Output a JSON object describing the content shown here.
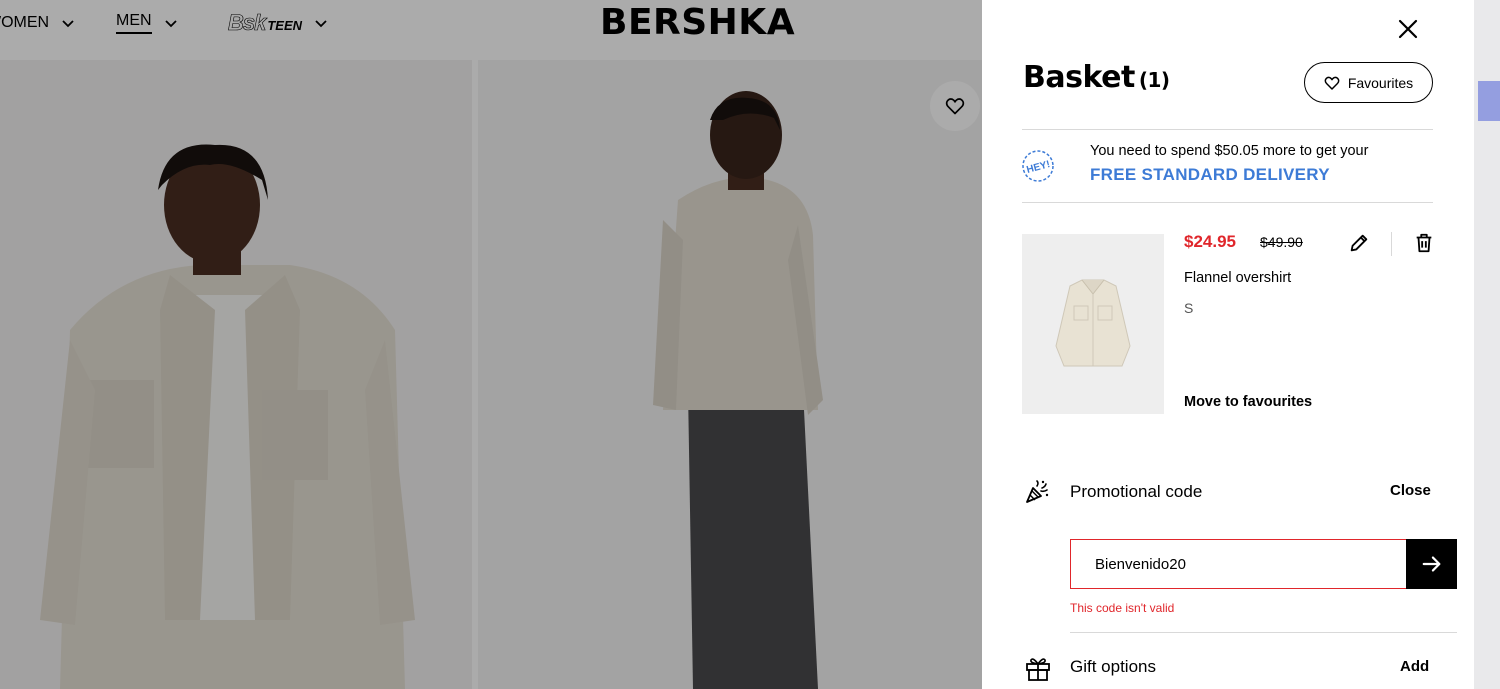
{
  "header": {
    "nav": [
      {
        "label": "WOMEN"
      },
      {
        "label": "MEN"
      },
      {
        "label": "TEEN",
        "logo_text": "Bsk"
      }
    ],
    "brand": "BERSHKA"
  },
  "colors": {
    "sale_price": "#e0262b",
    "delivery_link": "#3d7bd6",
    "error": "#e0262b"
  },
  "basket": {
    "title": "Basket",
    "count": "(1)",
    "favourites_label": "Favourites",
    "delivery": {
      "badge_text": "HEY!",
      "message": "You need to spend $50.05 more to get your",
      "link": "FREE STANDARD DELIVERY"
    },
    "item": {
      "price": "$24.95",
      "original_price": "$49.90",
      "name": "Flannel overshirt",
      "size": "S",
      "move_label": "Move to favourites"
    },
    "promo": {
      "label": "Promotional code",
      "close_label": "Close",
      "value": "Bienvenido20",
      "error": "This code isn't valid"
    },
    "gift": {
      "label": "Gift options",
      "add_label": "Add"
    }
  }
}
